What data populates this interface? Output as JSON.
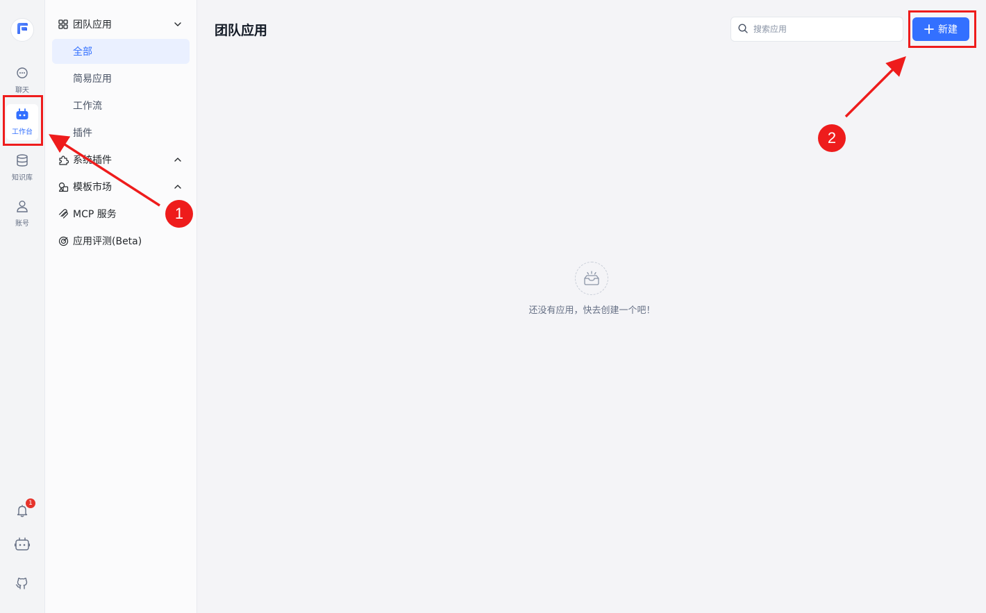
{
  "rail": {
    "items": [
      {
        "label": "聊天",
        "icon": "chat-icon"
      },
      {
        "label": "工作台",
        "icon": "robot-icon",
        "active": true
      },
      {
        "label": "知识库",
        "icon": "database-icon"
      },
      {
        "label": "账号",
        "icon": "user-icon"
      }
    ],
    "notification_count": "1",
    "bottom_icons": [
      "bell-icon",
      "robot-icon",
      "github-icon"
    ]
  },
  "nav": {
    "team_apps": "团队应用",
    "sub_items": [
      "全部",
      "简易应用",
      "工作流",
      "插件"
    ],
    "system_plugins": "系统插件",
    "template_market": "模板市场",
    "mcp_service": "MCP 服务",
    "app_eval": "应用评测(Beta)"
  },
  "main": {
    "title": "团队应用",
    "search_placeholder": "搜索应用",
    "new_button": "新建",
    "empty_text": "还没有应用，快去创建一个吧！"
  },
  "annotations": {
    "step1": "1",
    "step2": "2",
    "color": "#ee1c1c"
  },
  "colors": {
    "accent": "#3370ff",
    "active_bg": "#eaf0ff",
    "badge": "#e5342c"
  }
}
